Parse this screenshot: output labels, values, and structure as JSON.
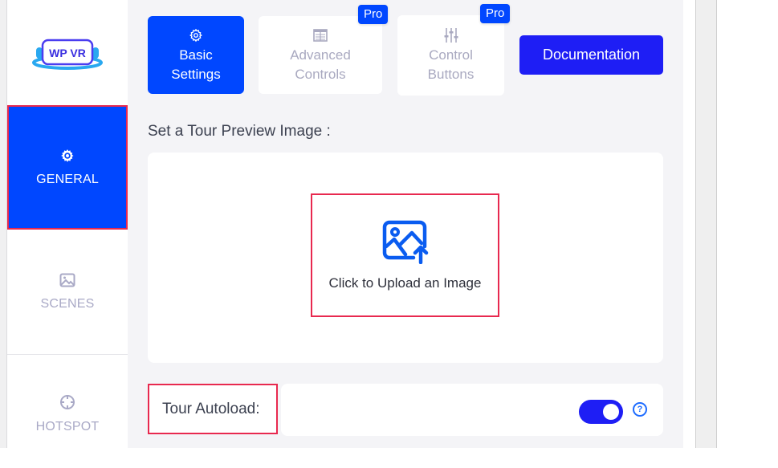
{
  "brand": {
    "logo_text": "WP VR",
    "accent": "#0047ff",
    "doc_button_color": "#1e1ef5",
    "highlight_outline": "#e8294f"
  },
  "sidebar": {
    "items": [
      {
        "label": "GENERAL",
        "icon": "gear-icon",
        "active": true
      },
      {
        "label": "SCENES",
        "icon": "image-icon",
        "active": false
      },
      {
        "label": "HOTSPOT",
        "icon": "crosshair-icon",
        "active": false
      }
    ]
  },
  "tabs": [
    {
      "line1": "Basic",
      "line2": "Settings",
      "icon": "gear-icon",
      "active": true,
      "pro": false
    },
    {
      "line1": "Advanced",
      "line2": "Controls",
      "icon": "table-icon",
      "active": false,
      "pro": true
    },
    {
      "line1": "Control",
      "line2": "Buttons",
      "icon": "sliders-icon",
      "active": false,
      "pro": true
    }
  ],
  "pro_badge": "Pro",
  "documentation_button": "Documentation",
  "preview": {
    "label": "Set a Tour Preview Image :",
    "upload_text": "Click to Upload an Image"
  },
  "autoload": {
    "label": "Tour Autoload:",
    "enabled": true,
    "help": "?"
  }
}
